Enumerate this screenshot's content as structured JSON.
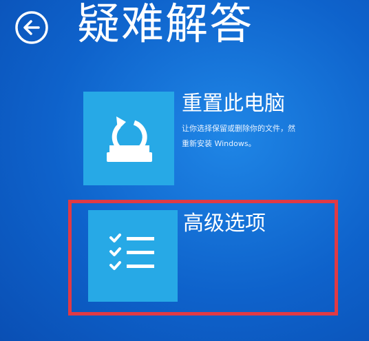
{
  "header": {
    "back_icon": "back-arrow-icon",
    "title": "疑难解答"
  },
  "options": {
    "reset": {
      "icon": "refresh-drive-icon",
      "title": "重置此电脑",
      "description_line1": "让你选择保留或删除你的文件，然",
      "description_line2": "重新安装 Windows。"
    },
    "advanced": {
      "icon": "checklist-icon",
      "title": "高级选项"
    }
  },
  "annotation": {
    "highlight_color": "#e03a45"
  },
  "colors": {
    "background": "#0e62cb",
    "tile": "#27a9e6",
    "text": "#ffffff"
  }
}
